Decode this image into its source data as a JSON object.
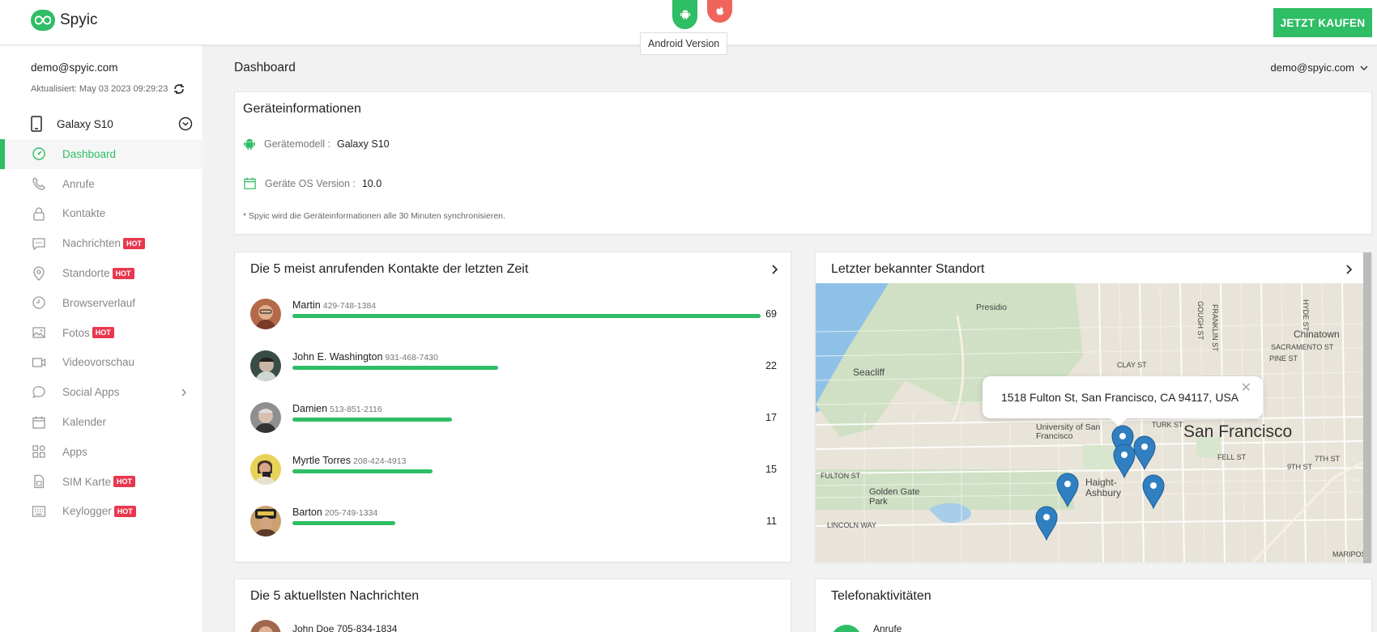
{
  "app": {
    "name": "Spyic",
    "buy_button": "JETZT KAUFEN"
  },
  "os_switch": {
    "tooltip": "Android Version"
  },
  "account": {
    "email": "demo@spyic.com",
    "updated": "Aktualisiert: May 03 2023 09:29:23",
    "device": "Galaxy S10"
  },
  "sidebar": {
    "items": [
      {
        "label": "Dashboard",
        "hot": "",
        "active": true
      },
      {
        "label": "Anrufe",
        "hot": ""
      },
      {
        "label": "Kontakte",
        "hot": ""
      },
      {
        "label": "Nachrichten",
        "hot": "HOT"
      },
      {
        "label": "Standorte",
        "hot": "HOT"
      },
      {
        "label": "Browserverlauf",
        "hot": ""
      },
      {
        "label": "Fotos",
        "hot": "HOT"
      },
      {
        "label": "Videovorschau",
        "hot": ""
      },
      {
        "label": "Social Apps",
        "hot": ""
      },
      {
        "label": "Kalender",
        "hot": ""
      },
      {
        "label": "Apps",
        "hot": ""
      },
      {
        "label": "SIM Karte",
        "hot": "HOT"
      },
      {
        "label": "Keylogger",
        "hot": "HOT"
      }
    ]
  },
  "header": {
    "title": "Dashboard",
    "user_menu": "demo@spyic.com"
  },
  "device_info": {
    "title": "Geräteinformationen",
    "model_label": "Gerätemodell :",
    "model_value": "Galaxy S10",
    "os_label": "Geräte OS Version :",
    "os_value": "10.0",
    "note": "* Spyic wird die Geräteinformationen alle 30 Minuten synchronisieren."
  },
  "top_contacts": {
    "title": "Die 5 meist anrufenden Kontakte der letzten Zeit",
    "rows": [
      {
        "name": "Martin",
        "phone": "429-748-1384",
        "count": "69",
        "fraction": 1.0
      },
      {
        "name": "John E. Washington",
        "phone": "931-468-7430",
        "count": "22",
        "fraction": 0.44
      },
      {
        "name": "Damien",
        "phone": "513-851-2116",
        "count": "17",
        "fraction": 0.34
      },
      {
        "name": "Myrtle Torres",
        "phone": "208-424-4913",
        "count": "15",
        "fraction": 0.3
      },
      {
        "name": "Barton",
        "phone": "205-749-1334",
        "count": "11",
        "fraction": 0.22
      }
    ]
  },
  "location": {
    "title": "Letzter bekannter Standort",
    "popup": "1518 Fulton St, San Francisco, CA 94117, USA",
    "map_labels": [
      "Presidio",
      "Seacliff",
      "Chinatown",
      "San Francisco",
      "University of San Francisco",
      "Haight-Ashbury",
      "Golden Gate Park",
      "FULTON ST",
      "LINCOLN WAY",
      "CLAY ST",
      "PINE ST",
      "SACRAMENTO ST",
      "TURK ST",
      "FELL ST",
      "9TH ST",
      "7TH ST",
      "HYDE ST",
      "FRANKLIN ST",
      "GOUGH ST",
      "MARIPOS"
    ]
  },
  "messages": {
    "title": "Die 5 aktuellsten Nachrichten",
    "first_partial": "John Doe 705-834-1834"
  },
  "phone_activity": {
    "title": "Telefonaktivitäten",
    "first_partial": "Anrufe"
  },
  "colors": {
    "accent": "#2fbd65",
    "hot": "#e8384f",
    "apple": "#f0645c",
    "pin": "#2f7fc1"
  }
}
